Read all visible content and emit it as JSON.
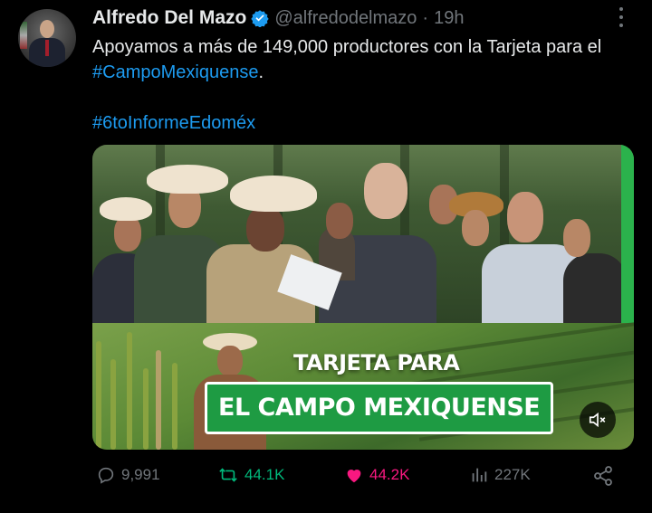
{
  "author": {
    "name": "Alfredo Del Mazo",
    "handle": "@alfredodelmazo",
    "separator": "·",
    "time": "19h"
  },
  "tweet": {
    "text_main": "Apoyamos a más de 149,000 productores con la Tarjeta para el ",
    "hashtag1": "#CampoMexiquense",
    "text_after": ".",
    "hashtag2": "#6toInformeEdoméx"
  },
  "media": {
    "banner_line1": "TARJETA PARA",
    "banner_line2": "EL CAMPO MEXIQUENSE",
    "mute_icon": "speaker-muted-icon"
  },
  "actions": {
    "replies": "9,991",
    "retweets": "44.1K",
    "likes": "44.2K",
    "views": "227K"
  },
  "colors": {
    "background": "#000000",
    "text": "#e7e9ea",
    "secondary": "#71767b",
    "link": "#1d9bf0",
    "retweet": "#00ba7c",
    "like": "#f91880",
    "banner_green": "#1e9b43"
  }
}
